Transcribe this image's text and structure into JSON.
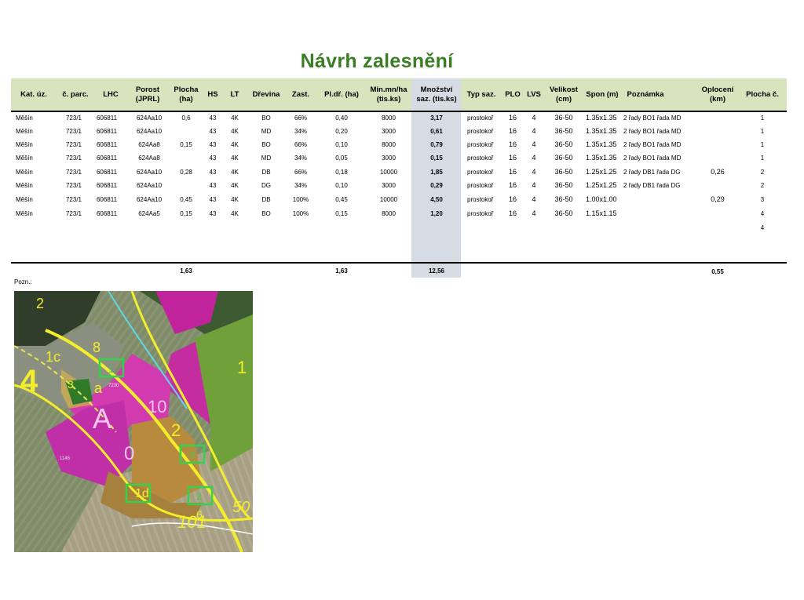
{
  "title": "Návrh zalesnění",
  "columns": [
    "Kat. úz.",
    "č. parc.",
    "LHC",
    "Porost (JPRL)",
    "Plocha (ha)",
    "HS",
    "LT",
    "Dřevina",
    "Zast.",
    "Pl.dř. (ha)",
    "Min.mn/ha (tis.ks)",
    "Množství saz. (tis.ks)",
    "Typ saz.",
    "PLO",
    "LVS",
    "Velikost (cm)",
    "Spon (m)",
    "Poznámka",
    "Oplocení (km)",
    "Plocha č."
  ],
  "headers": {
    "kat": "Kat. úz.",
    "parc": "č. parc.",
    "lhc": "LHC",
    "porost1": "Porost",
    "porost2": "(JPRL)",
    "plocha1": "Plocha",
    "plocha2": "(ha)",
    "hs": "HS",
    "lt": "LT",
    "drevina": "Dřevina",
    "zast": "Zast.",
    "pldr": "Pl.dř. (ha)",
    "minmn1": "Min.mn/ha",
    "minmn2": "(tis.ks)",
    "mnoz1": "Množství",
    "mnoz2": "saz. (tis.ks)",
    "typ": "Typ saz.",
    "plo": "PLO",
    "lvs": "LVS",
    "vel1": "Velikost",
    "vel2": "(cm)",
    "spon": "Spon (m)",
    "pozn": "Poznámka",
    "opl1": "Oplocení",
    "opl2": "(km)",
    "plc": "Plocha č."
  },
  "rows": [
    {
      "kat": "Měšín",
      "parc": "723/1",
      "lhc": "606811",
      "porost": "624Aa10",
      "plocha": "0,6",
      "hs": "43",
      "lt": "4K",
      "drevina": "BO",
      "zast": "66%",
      "pldr": "0,40",
      "minmn": "8000",
      "mnoz": "3,17",
      "typ": "prostokoř",
      "plo": "16",
      "lvs": "4",
      "vel": "36-50",
      "spon": "1.35x1.35",
      "pozn": "2 řady BO1 řada MD",
      "opl": "",
      "plc": "1"
    },
    {
      "kat": "Měšín",
      "parc": "723/1",
      "lhc": "606811",
      "porost": "624Aa10",
      "plocha": "",
      "hs": "43",
      "lt": "4K",
      "drevina": "MD",
      "zast": "34%",
      "pldr": "0,20",
      "minmn": "3000",
      "mnoz": "0,61",
      "typ": "prostokoř",
      "plo": "16",
      "lvs": "4",
      "vel": "36-50",
      "spon": "1.35x1.35",
      "pozn": "2 řady BO1 řada MD",
      "opl": "",
      "plc": "1"
    },
    {
      "kat": "Měšín",
      "parc": "723/1",
      "lhc": "606811",
      "porost": "624Aa8",
      "plocha": "0,15",
      "hs": "43",
      "lt": "4K",
      "drevina": "BO",
      "zast": "66%",
      "pldr": "0,10",
      "minmn": "8000",
      "mnoz": "0,79",
      "typ": "prostokoř",
      "plo": "16",
      "lvs": "4",
      "vel": "36-50",
      "spon": "1.35x1.35",
      "pozn": "2 řady BO1 řada MD",
      "opl": "",
      "plc": "1"
    },
    {
      "kat": "Měšín",
      "parc": "723/1",
      "lhc": "606811",
      "porost": "624Aa8",
      "plocha": "",
      "hs": "43",
      "lt": "4K",
      "drevina": "MD",
      "zast": "34%",
      "pldr": "0,05",
      "minmn": "3000",
      "mnoz": "0,15",
      "typ": "prostokoř",
      "plo": "16",
      "lvs": "4",
      "vel": "36-50",
      "spon": "1.35x1.35",
      "pozn": "2 řady BO1 řada MD",
      "opl": "",
      "plc": "1"
    },
    {
      "kat": "Měšín",
      "parc": "723/1",
      "lhc": "606811",
      "porost": "624Aa10",
      "plocha": "0,28",
      "hs": "43",
      "lt": "4K",
      "drevina": "DB",
      "zast": "66%",
      "pldr": "0,18",
      "minmn": "10000",
      "mnoz": "1,85",
      "typ": "prostokoř",
      "plo": "16",
      "lvs": "4",
      "vel": "36-50",
      "spon": "1.25x1.25",
      "pozn": "2 řady DB1 řada DG",
      "opl": "0,26",
      "plc": "2"
    },
    {
      "kat": "Měšín",
      "parc": "723/1",
      "lhc": "606811",
      "porost": "624Aa10",
      "plocha": "",
      "hs": "43",
      "lt": "4K",
      "drevina": "DG",
      "zast": "34%",
      "pldr": "0,10",
      "minmn": "3000",
      "mnoz": "0,29",
      "typ": "prostokoř",
      "plo": "16",
      "lvs": "4",
      "vel": "36-50",
      "spon": "1.25x1.25",
      "pozn": "2 řady DB1 řada DG",
      "opl": "",
      "plc": "2"
    },
    {
      "kat": "Měšín",
      "parc": "723/1",
      "lhc": "606811",
      "porost": "624Aa10",
      "plocha": "0,45",
      "hs": "43",
      "lt": "4K",
      "drevina": "DB",
      "zast": "100%",
      "pldr": "0,45",
      "minmn": "10000",
      "mnoz": "4,50",
      "typ": "prostokoř",
      "plo": "16",
      "lvs": "4",
      "vel": "36-50",
      "spon": "1.00x1.00",
      "pozn": "",
      "opl": "0,29",
      "plc": "3"
    },
    {
      "kat": "Měšín",
      "parc": "723/1",
      "lhc": "606811",
      "porost": "624Aa5",
      "plocha": "0,15",
      "hs": "43",
      "lt": "4K",
      "drevina": "BO",
      "zast": "100%",
      "pldr": "0,15",
      "minmn": "8000",
      "mnoz": "1,20",
      "typ": "prostokoř",
      "plo": "16",
      "lvs": "4",
      "vel": "36-50",
      "spon": "1.15x1.15",
      "pozn": "",
      "opl": "",
      "plc": "4"
    },
    {
      "kat": "",
      "parc": "",
      "lhc": "",
      "porost": "",
      "plocha": "",
      "hs": "",
      "lt": "",
      "drevina": "",
      "zast": "",
      "pldr": "",
      "minmn": "",
      "mnoz": "",
      "typ": "",
      "plo": "",
      "lvs": "",
      "vel": "",
      "spon": "",
      "pozn": "",
      "opl": "",
      "plc": "4"
    }
  ],
  "totals": {
    "plocha": "1,63",
    "pldr": "1,63",
    "mnoz": "12,56",
    "opl": "0,55"
  },
  "pozn_label": "Pozn.:",
  "map": {
    "labels": {
      "l2": "2",
      "l1c": "1c",
      "l8": "8",
      "l4": "4",
      "l3": "3",
      "la": "a",
      "lA": "A",
      "l10": "10",
      "l0": "0",
      "lmid2": "2",
      "l1d": "1d",
      "l1": "1",
      "l50": "50",
      "l101": "101",
      "l6": "6",
      "l1146": "1146",
      "l7230": "7230",
      "box1": "1",
      "box3": "3",
      "box4": "4",
      "box2": "2"
    }
  }
}
